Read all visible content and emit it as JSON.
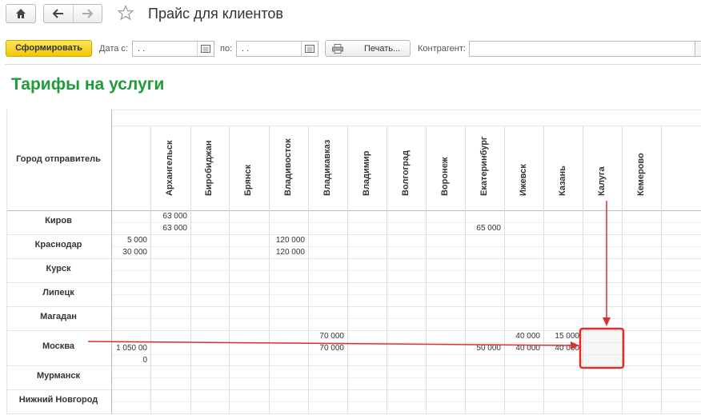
{
  "window": {
    "title": "Прайс для клиентов"
  },
  "toolbar": {
    "generate_label": "Сформировать",
    "date_from_label": "Дата с:",
    "date_from_value": ". .",
    "date_to_label": "по:",
    "date_to_value": ". .",
    "print_label": "Печать...",
    "counterparty_label": "Контрагент:",
    "counterparty_value": ""
  },
  "report": {
    "title": "Тарифы на услуги",
    "sender_header": "Город отправитель",
    "cities": [
      "Архангельск",
      "Биробиджан",
      "Брянск",
      "Владивосток",
      "Владикавказ",
      "Владимир",
      "Волгоград",
      "Воронеж",
      "Екатеринбург",
      "Ижевск",
      "Казань",
      "Калуга",
      "Кемерово"
    ],
    "rows": [
      {
        "name": "Киров",
        "cells": [
          {
            "col": 1,
            "line": 0,
            "v": "63 000"
          },
          {
            "col": 1,
            "line": 1,
            "v": "63 000"
          },
          {
            "col": 9,
            "line": 1,
            "v": "65 000"
          }
        ]
      },
      {
        "name": "Краснодар",
        "cells": [
          {
            "col": 0,
            "line": 0,
            "v": "5 000"
          },
          {
            "col": 0,
            "line": 1,
            "v": "30 000"
          },
          {
            "col": 4,
            "line": 0,
            "v": "120 000"
          },
          {
            "col": 4,
            "line": 1,
            "v": "120 000"
          }
        ]
      },
      {
        "name": "Курск",
        "cells": []
      },
      {
        "name": "Липецк",
        "cells": []
      },
      {
        "name": "Магадан",
        "cells": []
      },
      {
        "name": "Москва",
        "cells": [
          {
            "col": 5,
            "line": 0,
            "v": "70 000"
          },
          {
            "col": 5,
            "line": 1,
            "v": "70 000"
          },
          {
            "col": 0,
            "line": 1,
            "v": "1 050 00"
          },
          {
            "col": 0,
            "line": 2,
            "v": "0"
          },
          {
            "col": 9,
            "line": 1,
            "v": "50 000"
          },
          {
            "col": 10,
            "line": 0,
            "v": "40 000"
          },
          {
            "col": 10,
            "line": 1,
            "v": "40 000"
          },
          {
            "col": 11,
            "line": 0,
            "v": "15 000"
          },
          {
            "col": 11,
            "line": 1,
            "v": "40 000"
          }
        ]
      },
      {
        "name": "Мурманск",
        "cells": []
      },
      {
        "name": "Нижний Новгород",
        "cells": []
      }
    ]
  },
  "colors": {
    "accent_yellow": "#f5d20a",
    "title_green": "#1f9b3a",
    "highlight_red": "#d9302b"
  },
  "icons": {
    "home": "home-icon",
    "back": "arrow-left-icon",
    "forward": "arrow-right-icon",
    "favorite": "star-icon",
    "calendar": "calendar-icon",
    "printer": "printer-icon"
  }
}
